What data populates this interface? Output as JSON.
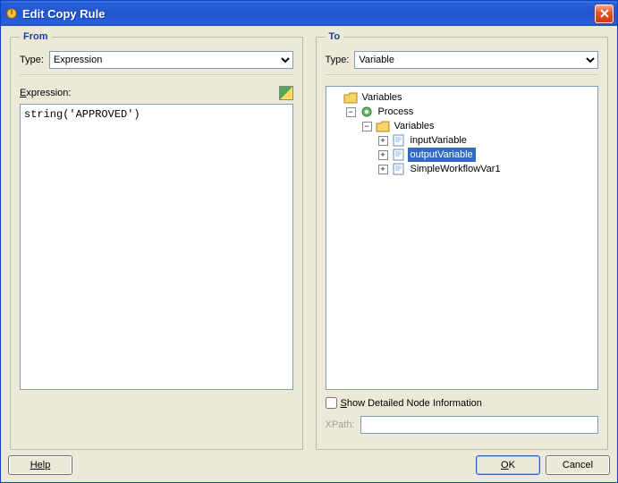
{
  "window": {
    "title": "Edit Copy Rule"
  },
  "from": {
    "legend": "From",
    "type_label": "Type:",
    "type_value": "Expression",
    "expression_label_pre": "E",
    "expression_label_rest": "xpression:",
    "expression_value": "string('APPROVED')"
  },
  "to": {
    "legend": "To",
    "type_label": "Type:",
    "type_value": "Variable",
    "show_detail_pre": "S",
    "show_detail_rest": "how Detailed Node Information",
    "show_detail_checked": false,
    "xpath_label": "XPath:",
    "xpath_value": "",
    "tree": {
      "root": "Variables",
      "process": "Process",
      "vars_folder": "Variables",
      "items": [
        {
          "label": "inputVariable"
        },
        {
          "label": "outputVariable",
          "selected": true
        },
        {
          "label": "SimpleWorkflowVar1"
        }
      ]
    }
  },
  "buttons": {
    "help": "Help",
    "ok_pre": "O",
    "ok_rest": "K",
    "cancel": "Cancel"
  }
}
